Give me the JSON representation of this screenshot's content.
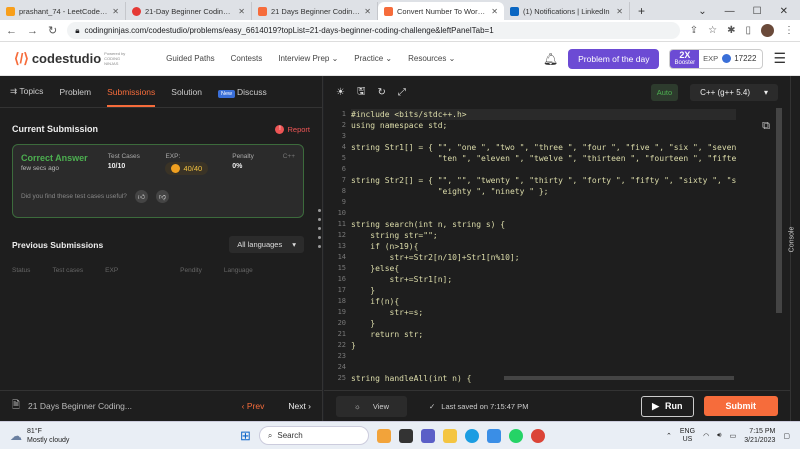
{
  "browser": {
    "tabs": [
      {
        "title": "prashant_74 - LeetCode Profi",
        "color": "#f89f1b"
      },
      {
        "title": "21-Day Beginner Coding Cha",
        "color": "#e53935"
      },
      {
        "title": "21 Days Beginner Coding Ch",
        "color": "#f66c3b"
      },
      {
        "title": "Convert Number To Words -",
        "color": "#f66c3b"
      },
      {
        "title": "(1) Notifications | LinkedIn",
        "color": "#0a66c2"
      }
    ],
    "url": "codingninjas.com/codestudio/problems/easy_6614019?topList=21-days-beginner-coding-challenge&leftPanelTab=1"
  },
  "header": {
    "logo": "codestudio",
    "logo_sub": "Powered by CODING NINJAS",
    "menu": [
      "Guided Paths",
      "Contests",
      "Interview Prep ⌄",
      "Practice ⌄",
      "Resources ⌄"
    ],
    "problem_of_day": "Problem of the day",
    "booster_top": "2X",
    "booster_bottom": "Booster",
    "xp_label": "EXP",
    "xp_value": "17222"
  },
  "left": {
    "tabs": {
      "topics": "Topics",
      "problem": "Problem",
      "submissions": "Submissions",
      "solution": "Solution",
      "new": "New",
      "discuss": "Discuss"
    },
    "current_title": "Current Submission",
    "report": "Report",
    "card": {
      "status": "Correct Answer",
      "time": "few secs ago",
      "tc_label": "Test Cases",
      "tc_value": "10/10",
      "exp_label": "EXP:",
      "exp_value": "40/40",
      "pen_label": "Penalty",
      "pen_value": "0%",
      "lang": "C++",
      "question": "Did you find these test cases useful?"
    },
    "prev_title": "Previous Submissions",
    "lang_filter": "All languages",
    "columns": [
      "Status",
      "Test cases",
      "EXP",
      "Pendity",
      "Language"
    ],
    "footer": {
      "list": "21 Days Beginner Coding...",
      "prev": "‹ Prev",
      "next": "Next ›"
    }
  },
  "right": {
    "auto": "Auto",
    "lang": "C++ (g++ 5.4)",
    "lines": [
      "#include <bits/stdc++.h>",
      "using namespace std;",
      "",
      "string Str1[] = { \"\", \"one \", \"two \", \"three \", \"four \", \"five \", \"six \", \"seven",
      "                  \"ten \", \"eleven \", \"twelve \", \"thirteen \", \"fourteen \", \"fifte",
      "",
      "string Str2[] = { \"\", \"\", \"twenty \", \"thirty \", \"forty \", \"fifty \", \"sixty \", \"s",
      "                  \"eighty \", \"ninety \" };",
      "",
      "",
      "string search(int n, string s) {",
      "    string str=\"\";",
      "    if (n>19){",
      "        str+=Str2[n/10]+Str1[n%10];",
      "    }else{",
      "        str+=Str1[n];",
      "    }",
      "    if(n){",
      "        str+=s;",
      "    }",
      "    return str;",
      "}",
      "",
      "",
      "string handleAll(int n) {"
    ],
    "line_numbers": [
      "1",
      "2",
      "3",
      "4",
      "5",
      "6",
      "7",
      "8",
      "9",
      "10",
      "11",
      "12",
      "13",
      "14",
      "15",
      "16",
      "17",
      "18",
      "19",
      "20",
      "21",
      "22",
      "23",
      "24",
      "25"
    ],
    "view": "View",
    "saved": "Last saved on 7:15:47 PM",
    "run": "Run",
    "submit": "Submit",
    "console": "Console"
  },
  "taskbar": {
    "temp": "81°F",
    "weather": "Mostly cloudy",
    "search": "Search",
    "lang1": "ENG",
    "lang2": "US",
    "time": "7:15 PM",
    "date": "3/21/2023"
  }
}
